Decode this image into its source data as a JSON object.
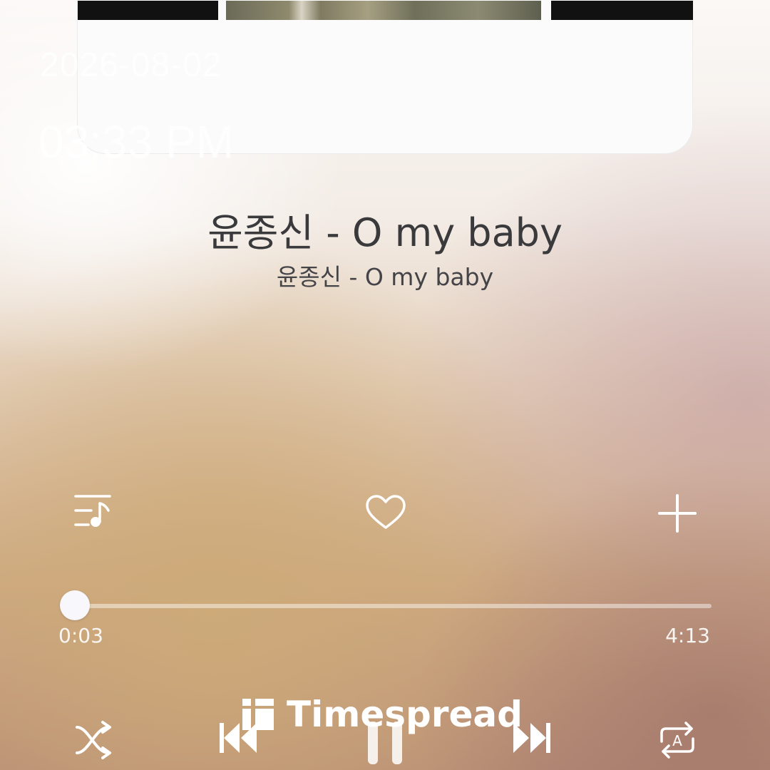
{
  "album_art": {
    "description_icon": "album-art-image"
  },
  "overlay": {
    "date": "2026-08-02",
    "time": "03:33 PM"
  },
  "track": {
    "title": "윤종신 - O my baby",
    "subtitle": "윤종신 - O my baby"
  },
  "actions": {
    "playlist_icon": "queue-music-icon",
    "favorite_icon": "heart-icon",
    "add_icon": "plus-icon"
  },
  "progress": {
    "elapsed": "0:03",
    "total": "4:13",
    "fraction": 0.012
  },
  "controls": {
    "shuffle_icon": "shuffle-icon",
    "previous_icon": "skip-previous-icon",
    "play_pause_icon": "pause-icon",
    "next_icon": "skip-next-icon",
    "repeat_icon": "repeat-a-icon"
  },
  "watermark": {
    "text": "Timespread"
  }
}
